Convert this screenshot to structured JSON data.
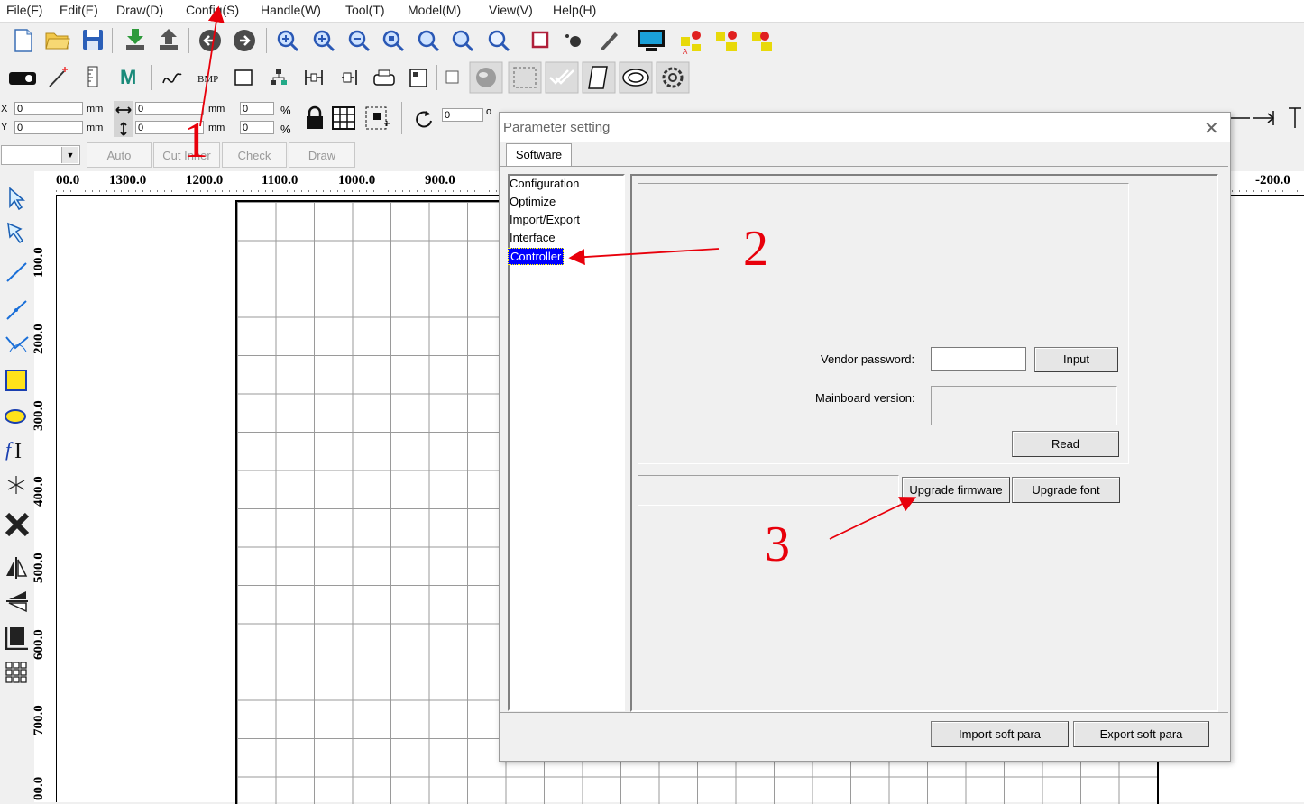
{
  "menu": [
    "File(F)",
    "Edit(E)",
    "Draw(D)",
    "Config(S)",
    "Handle(W)",
    "Tool(T)",
    "Model(M)",
    "View(V)",
    "Help(H)"
  ],
  "coords": {
    "x_label": "X",
    "y_label": "Y",
    "x_value": "0",
    "y_value": "0",
    "w_value": "0",
    "h_value": "0",
    "unit1": "mm",
    "unit2": "mm",
    "unit3": "mm",
    "unit4": "mm",
    "pct_w": "0",
    "pct_h": "0",
    "pct1": "%",
    "pct2": "%",
    "rotate_value": "0",
    "rotate_unit": "o"
  },
  "process_buttons": {
    "auto": "Auto",
    "cut_inner": "Cut Inner",
    "check": "Check",
    "draw": "Draw"
  },
  "ruler": {
    "h_ticks": [
      "00.0",
      "1300.0",
      "1200.0",
      "1100.0",
      "1000.0",
      "900.0",
      "-200.0"
    ],
    "v_ticks": [
      "100.0",
      "200.0",
      "300.0",
      "400.0",
      "500.0",
      "600.0",
      "700.0",
      "00.0"
    ]
  },
  "dialog": {
    "title": "Parameter setting",
    "tab": "Software",
    "tree": [
      "Configuration",
      "Optimize",
      "Import/Export",
      "Interface",
      "Controller"
    ],
    "selected_index": 4,
    "vendor_password_label": "Vendor password:",
    "vendor_password_value": "",
    "input_button": "Input",
    "mainboard_version_label": "Mainboard version:",
    "mainboard_version_value": "",
    "read_button": "Read",
    "upgrade_firmware_button": "Upgrade firmware",
    "upgrade_font_button": "Upgrade font",
    "import_button": "Import soft para",
    "export_button": "Export soft para"
  },
  "annotations": {
    "step1": "1",
    "step2": "2",
    "step3": "3"
  },
  "colors": {
    "selection": "#0000ff",
    "annotation": "#e8000b",
    "grid_line": "#9a9a9a"
  },
  "icons": {
    "main_toolbar": [
      "new-file-icon",
      "open-folder-icon",
      "save-icon",
      "import-icon",
      "export-icon",
      "undo-icon",
      "redo-icon",
      "zoom-in-icon",
      "zoom-in-2-icon",
      "zoom-out-icon",
      "zoom-page-icon",
      "zoom-fit-icon",
      "zoom-select-icon",
      "zoom-icon",
      "stop-icon",
      "camera-icon",
      "pen-icon",
      "monitor-icon",
      "output-icon",
      "output2-icon",
      "output3-icon"
    ],
    "left_tools": [
      "select-arrow-icon",
      "node-edit-icon",
      "line-icon",
      "polyline-icon",
      "curve-icon",
      "rectangle-icon",
      "ellipse-icon",
      "text-icon",
      "star-icon",
      "delete-icon",
      "mirror-h-icon",
      "mirror-v-icon",
      "align-icon",
      "array-icon"
    ]
  }
}
